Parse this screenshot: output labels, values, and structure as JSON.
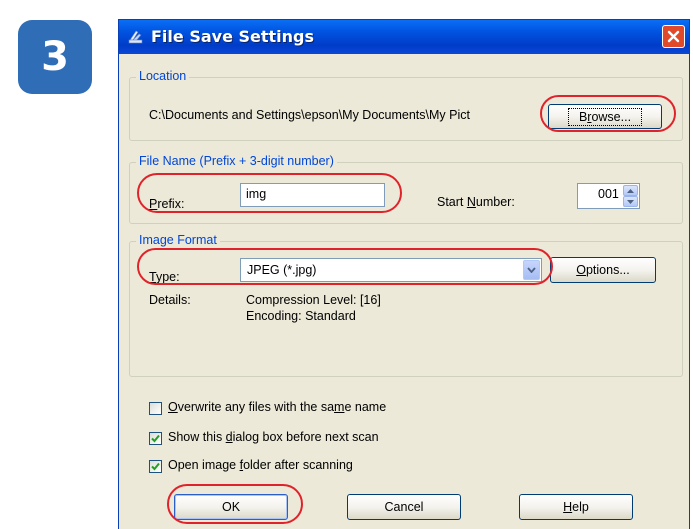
{
  "step": {
    "number": "3"
  },
  "dialog": {
    "title": "File Save Settings",
    "location": {
      "legend": "Location",
      "path": "C:\\Documents and Settings\\epson\\My Documents\\My Pict",
      "browse_pre": "B",
      "browse_ul": "r",
      "browse_post": "owse..."
    },
    "file_name": {
      "legend": "File Name (Prefix + 3-digit number)",
      "prefix_ul": "P",
      "prefix_rest": "refix:",
      "prefix_value": "img",
      "start_pre": "Start ",
      "start_ul": "N",
      "start_post": "umber:",
      "start_value": "001"
    },
    "image_format": {
      "legend": "Image Format",
      "type_ul": "T",
      "type_rest": "ype:",
      "type_value": "JPEG (*.jpg)",
      "options_ul": "O",
      "options_rest": "ptions...",
      "details_label": "Details:",
      "details_line1": "Compression Level: [16]",
      "details_line2": "Encoding: Standard"
    },
    "checkboxes": [
      {
        "pre": "",
        "ul": "O",
        "mid": "verwrite any files with the sa",
        "ul2": "m",
        "post": "e name",
        "checked": false
      },
      {
        "pre": "Show this ",
        "ul": "d",
        "mid": "ialog box before next scan",
        "ul2": "",
        "post": "",
        "checked": true
      },
      {
        "pre": "Open image ",
        "ul": "f",
        "mid": "older after scanning",
        "ul2": "",
        "post": "",
        "checked": true
      }
    ],
    "buttons": {
      "ok": "OK",
      "cancel": "Cancel",
      "help_ul": "H",
      "help_rest": "elp"
    }
  },
  "colors": {
    "step_badge": "#2f6db6",
    "titlebar": "#0054e3",
    "dialog_bg": "#ece9d8",
    "legend_text": "#0046d5",
    "highlight": "#e0232b"
  },
  "icons": [
    "scanner-icon",
    "close-icon",
    "dropdown-arrow-icon",
    "spin-up-icon",
    "spin-down-icon",
    "checkmark-icon"
  ]
}
